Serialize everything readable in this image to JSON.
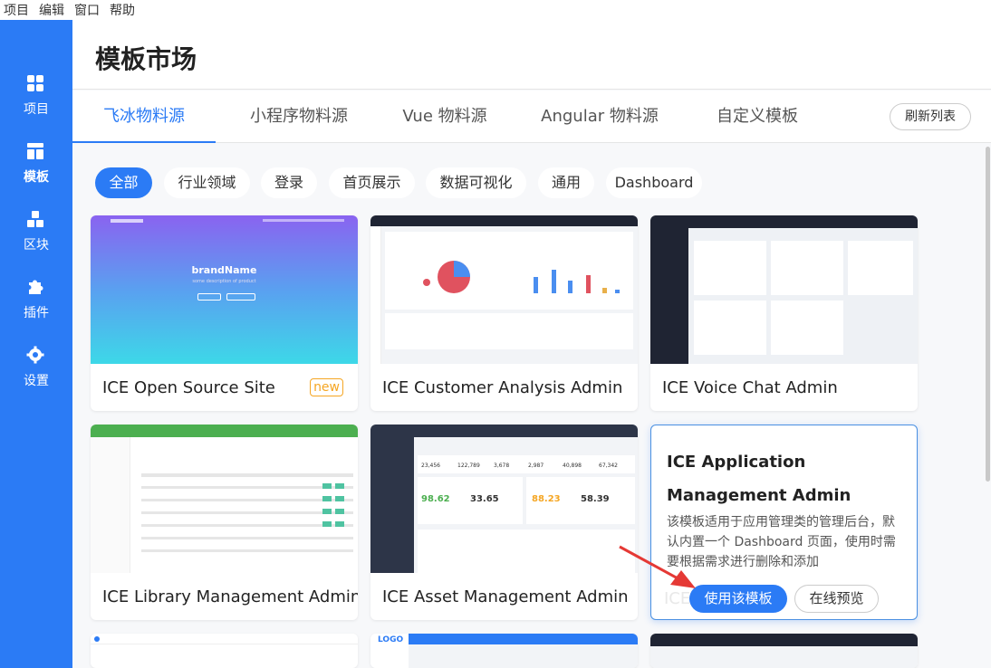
{
  "menubar": [
    "项目",
    "编辑",
    "窗口",
    "帮助"
  ],
  "sidebar": [
    {
      "label": "项目",
      "icon": "dashboard-grid-icon"
    },
    {
      "label": "模板",
      "icon": "layout-template-icon"
    },
    {
      "label": "区块",
      "icon": "blocks-icon"
    },
    {
      "label": "插件",
      "icon": "puzzle-icon"
    },
    {
      "label": "设置",
      "icon": "gear-icon"
    }
  ],
  "page": {
    "title": "模板市场"
  },
  "tabs": [
    "飞冰物料源",
    "小程序物料源",
    "Vue 物料源",
    "Angular 物料源",
    "自定义模板"
  ],
  "refresh_label": "刷新列表",
  "filters": [
    "全部",
    "行业领域",
    "登录",
    "首页展示",
    "数据可视化",
    "通用",
    "Dashboard"
  ],
  "cards": [
    {
      "title": "ICE Open Source Site",
      "badge": "new"
    },
    {
      "title": "ICE Customer Analysis Admin"
    },
    {
      "title": "ICE Voice Chat Admin"
    },
    {
      "title": "ICE Library Management Admin"
    },
    {
      "title": "ICE Asset Management Admin"
    }
  ],
  "hover_card": {
    "title": "ICE Application Management Admin",
    "description": "该模板适用于应用管理类的管理后台，默认内置一个 Dashboard 页面，使用时需要根据需求进行删除和添加",
    "use_label": "使用该模板",
    "preview_label": "在线预览",
    "ghost": "ICE"
  },
  "thumbs": {
    "open_source": {
      "brand": "brandName",
      "sub": "some description of product"
    },
    "asset_stats": [
      "98.62",
      "33.65",
      "88.23",
      "58.39"
    ],
    "asset_top": [
      "23,456",
      "122,789",
      "3,678",
      "2,987",
      "40,898",
      "67,342"
    ],
    "bottom_logo": "LOGO"
  },
  "colors": {
    "accent": "#2b7bf5",
    "sidebar": "#2b7bf5",
    "new_badge": "#f5a623",
    "arrow": "#e53935"
  }
}
